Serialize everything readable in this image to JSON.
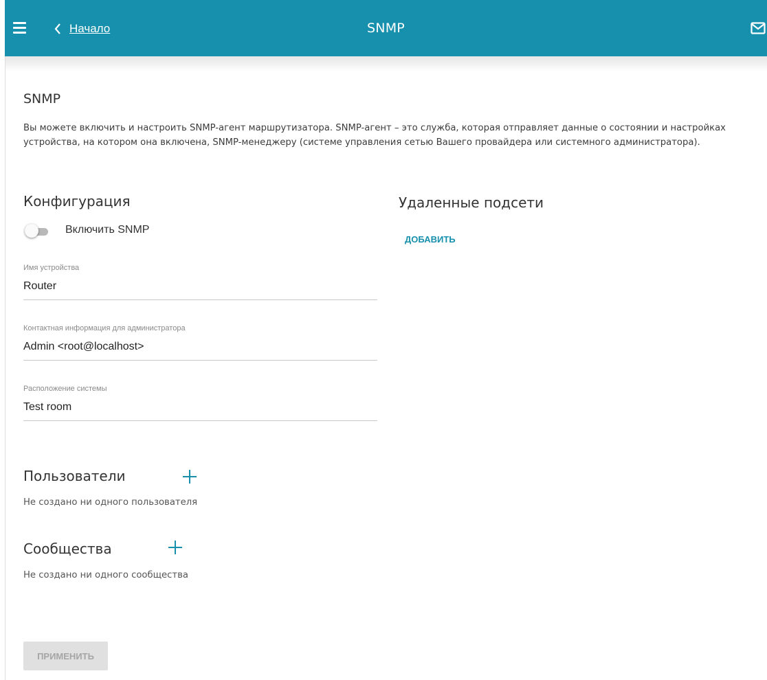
{
  "header": {
    "back_label": "Начало",
    "title": "SNMP",
    "accent_color": "#1690ad"
  },
  "page": {
    "title": "SNMP",
    "description": "Вы можете включить и настроить SNMP-агент маршрутизатора. SNMP-агент – это служба, которая отправляет данные о состоянии и настройках устройства, на котором она включена, SNMP-менеджеру (системе управления сетью Вашего провайдера или системного администратора)."
  },
  "config": {
    "title": "Конфигурация",
    "enable_label": "Включить SNMP",
    "enabled": false,
    "fields": [
      {
        "label": "Имя устройства",
        "value": "Router"
      },
      {
        "label": "Контактная информация для администратора",
        "value": "Admin <root@localhost>"
      },
      {
        "label": "Расположение системы",
        "value": "Test room"
      }
    ]
  },
  "subnets": {
    "title": "Удаленные подсети",
    "add_label": "ДОБАВИТЬ"
  },
  "users": {
    "title": "Пользователи",
    "empty": "Не создано ни одного пользователя"
  },
  "communities": {
    "title": "Сообщества",
    "empty": "Не создано ни одного сообщества"
  },
  "apply_label": "ПРИМЕНИТЬ",
  "icons": [
    "menu-icon",
    "chevron-left-icon",
    "mail-icon",
    "plus-icon"
  ]
}
